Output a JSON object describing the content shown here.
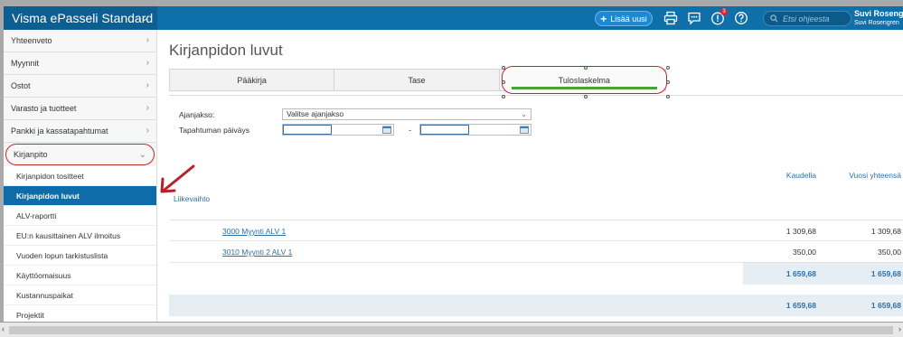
{
  "app": {
    "title": "Visma ePasseli Standard"
  },
  "topbar": {
    "add_label": "Lisää uusi",
    "notification_count": "3",
    "search_placeholder": "Etsi ohjeesta",
    "user_name": "Suvi Rosengren",
    "user_org": "Suvi Rosengren"
  },
  "sidebar": {
    "items": [
      {
        "label": "Yhteenveto"
      },
      {
        "label": "Myynnit"
      },
      {
        "label": "Ostot"
      },
      {
        "label": "Varasto ja tuotteet"
      },
      {
        "label": "Pankki ja kassatapahtumat"
      },
      {
        "label": "Kirjanpito"
      }
    ],
    "sub_items": [
      {
        "label": "Kirjanpidon tositteet"
      },
      {
        "label": "Kirjanpidon luvut"
      },
      {
        "label": "ALV-raportti"
      },
      {
        "label": "EU:n kausittainen ALV ilmoitus"
      },
      {
        "label": "Vuoden lopun tarkistuslista"
      },
      {
        "label": "Käyttöomaisuus"
      },
      {
        "label": "Kustannuspaikat"
      },
      {
        "label": "Projektit"
      }
    ]
  },
  "main": {
    "title": "Kirjanpidon luvut",
    "tabs": [
      {
        "label": "Pääkirja"
      },
      {
        "label": "Tase"
      },
      {
        "label": "Tuloslaskelma"
      }
    ],
    "filters": {
      "period_label": "Ajanjakso:",
      "period_value": "Valitse ajanjakso",
      "date_label": "Tapahtuman päiväys",
      "date_separator": "-"
    },
    "columns": {
      "period": "Kaudella",
      "year": "Vuosi yhteensä"
    },
    "section": "Liikevaihto",
    "rows": [
      {
        "account": "3000 Myynti ALV 1",
        "period": "1 309,68",
        "year": "1 309,68"
      },
      {
        "account": "3010 Myynti 2 ALV 1",
        "period": "350,00",
        "year": "350,00"
      }
    ],
    "subtotal": {
      "period": "1 659,68",
      "year": "1 659,68"
    },
    "total": {
      "period": "1 659,68",
      "year": "1 659,68"
    }
  },
  "colors": {
    "topbar": "#0f6fa8",
    "active_nav": "#0e6ca8",
    "highlight_circle": "#c0282d",
    "tab_underline": "#4aa033",
    "link": "#2d6fa7"
  }
}
